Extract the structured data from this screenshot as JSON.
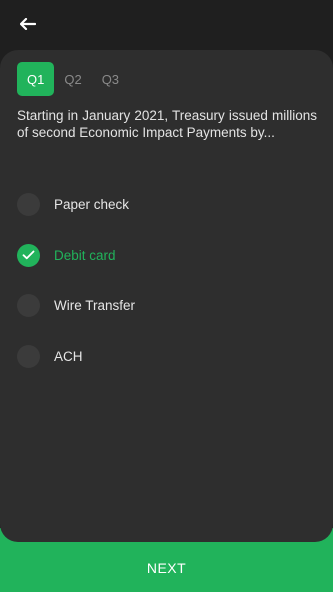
{
  "header": {
    "back_icon": "arrow-left-icon"
  },
  "quiz": {
    "tabs": [
      {
        "label": "Q1",
        "active": true
      },
      {
        "label": "Q2",
        "active": false
      },
      {
        "label": "Q3",
        "active": false
      }
    ],
    "question": "Starting in January 2021, Treasury issued millions of second Economic Impact Payments by...",
    "options": [
      {
        "label": "Paper check",
        "selected": false
      },
      {
        "label": "Debit card",
        "selected": true
      },
      {
        "label": "Wire Transfer",
        "selected": false
      },
      {
        "label": "ACH",
        "selected": false
      }
    ]
  },
  "footer": {
    "next_label": "NEXT"
  },
  "colors": {
    "accent": "#21b35b",
    "background": "#1f1f1f",
    "card": "#2e2e2e",
    "radio_unselected": "#3b3b3b"
  }
}
